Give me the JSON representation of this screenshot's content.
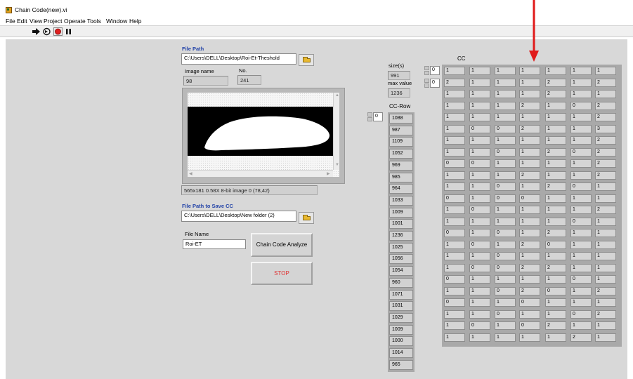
{
  "window": {
    "title": "Chain Code(new).vi"
  },
  "menu": [
    "File",
    "Edit",
    "View",
    "Project",
    "Operate",
    "Tools",
    "Window",
    "Help"
  ],
  "toolbar": {
    "icons": [
      "run-arrow-icon",
      "run-continuously-icon",
      "abort-icon",
      "pause-icon"
    ]
  },
  "file_path": {
    "label": "File Path",
    "value": "C:\\Users\\DELL\\Desktop\\Roi-Et-Theshold"
  },
  "image_name": {
    "label": "Image name",
    "value": "98"
  },
  "no": {
    "label": "No.",
    "value": "241"
  },
  "image_info": "565x181 0.58X 8-bit image 0   (78,42)",
  "save_path": {
    "label": "File Path to Save CC",
    "value": "C:\\Users\\DELL\\Desktop\\New folder (2)"
  },
  "file_name": {
    "label": "File Name",
    "value": "Roi-ET"
  },
  "buttons": {
    "analyze": "Chain Code Analyze",
    "stop": "STOP"
  },
  "size": {
    "label": "size(s)",
    "value": "991"
  },
  "max_value": {
    "label": "max value",
    "value": "1236"
  },
  "cc_row": {
    "label": "CC-Row",
    "index": "0",
    "values": [
      "1088",
      "987",
      "1109",
      "1052",
      "969",
      "985",
      "964",
      "1033",
      "1009",
      "1001",
      "1236",
      "1025",
      "1056",
      "1054",
      "960",
      "1071",
      "1031",
      "1029",
      "1009",
      "1000",
      "1014",
      "965"
    ]
  },
  "cc": {
    "label": "CC",
    "row_index": "0",
    "col_index": "0",
    "rows": [
      [
        "1",
        "1",
        "1",
        "1",
        "1",
        "1",
        "1"
      ],
      [
        "2",
        "1",
        "1",
        "1",
        "2",
        "1",
        "2"
      ],
      [
        "1",
        "1",
        "1",
        "1",
        "2",
        "1",
        "1"
      ],
      [
        "1",
        "1",
        "1",
        "2",
        "1",
        "0",
        "2"
      ],
      [
        "1",
        "1",
        "1",
        "1",
        "1",
        "1",
        "2"
      ],
      [
        "1",
        "0",
        "0",
        "2",
        "1",
        "1",
        "3"
      ],
      [
        "1",
        "1",
        "1",
        "1",
        "1",
        "1",
        "2"
      ],
      [
        "1",
        "1",
        "0",
        "1",
        "2",
        "0",
        "2"
      ],
      [
        "0",
        "0",
        "1",
        "1",
        "1",
        "1",
        "2"
      ],
      [
        "1",
        "1",
        "1",
        "2",
        "1",
        "1",
        "2"
      ],
      [
        "1",
        "1",
        "0",
        "1",
        "2",
        "0",
        "1"
      ],
      [
        "0",
        "1",
        "0",
        "0",
        "1",
        "1",
        "1"
      ],
      [
        "1",
        "0",
        "1",
        "1",
        "1",
        "1",
        "2"
      ],
      [
        "1",
        "1",
        "1",
        "1",
        "1",
        "0",
        "1"
      ],
      [
        "0",
        "1",
        "0",
        "1",
        "2",
        "1",
        "1"
      ],
      [
        "1",
        "0",
        "1",
        "2",
        "0",
        "1",
        "1"
      ],
      [
        "1",
        "1",
        "0",
        "1",
        "1",
        "1",
        "1"
      ],
      [
        "1",
        "0",
        "0",
        "2",
        "2",
        "1",
        "1"
      ],
      [
        "0",
        "1",
        "1",
        "1",
        "1",
        "0",
        "1"
      ],
      [
        "1",
        "1",
        "0",
        "2",
        "0",
        "1",
        "2"
      ],
      [
        "0",
        "1",
        "1",
        "0",
        "1",
        "1",
        "1"
      ],
      [
        "1",
        "1",
        "0",
        "1",
        "1",
        "0",
        "2"
      ],
      [
        "1",
        "0",
        "1",
        "0",
        "2",
        "1",
        "1"
      ],
      [
        "1",
        "1",
        "1",
        "1",
        "1",
        "2",
        "1"
      ]
    ]
  },
  "colors": {
    "stop_text": "#e03030",
    "label_blue": "#2545a8",
    "annotation_arrow": "#e01a1a"
  }
}
